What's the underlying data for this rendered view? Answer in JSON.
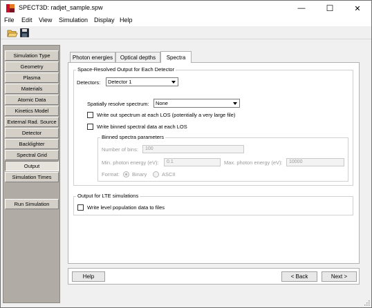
{
  "window": {
    "title": "SPECT3D:  radjet_sample.spw",
    "minimize": "—",
    "maximize": "☐",
    "close": "✕"
  },
  "menu": [
    {
      "label": "File"
    },
    {
      "label": "Edit"
    },
    {
      "label": "View"
    },
    {
      "label": "Simulation"
    },
    {
      "label": "Display"
    },
    {
      "label": "Help"
    }
  ],
  "toolbar": {
    "open_icon": "folder-open-icon",
    "save_icon": "floppy-disk-icon"
  },
  "sidebar": {
    "items": [
      {
        "label": "Simulation Type"
      },
      {
        "label": "Geometry"
      },
      {
        "label": "Plasma"
      },
      {
        "label": "Materials"
      },
      {
        "label": "Atomic Data"
      },
      {
        "label": "Kinetics Model"
      },
      {
        "label": "External Rad. Source"
      },
      {
        "label": "Detector"
      },
      {
        "label": "Backlighter"
      },
      {
        "label": "Spectral Grid"
      },
      {
        "label": "Output",
        "active": true
      },
      {
        "label": "Simulation Times"
      }
    ],
    "run_label": "Run Simulation"
  },
  "tabs": [
    {
      "label": "Photon energies"
    },
    {
      "label": "Optical depths"
    },
    {
      "label": "Spectra",
      "selected": true
    }
  ],
  "space_resolved": {
    "group_title": "Space-Resolved Output for Each Detector",
    "detectors_label": "Detectors:",
    "detectors_value": "Detector 1",
    "spatially_label": "Spatially resolve spectrum:",
    "spatially_value": "None",
    "write_out_label": "Write out spectrum at each LOS (potentially a very large file)",
    "write_out_checked": false,
    "write_binned_label": "Write binned spectral data at each LOS",
    "write_binned_checked": false,
    "binned": {
      "group_title": "Binned spectra parameters",
      "num_bins_label": "Number of bins:",
      "num_bins_value": "100",
      "min_energy_label": "Min. photon energy (eV):",
      "min_energy_value": "0.1",
      "max_energy_label": "Max. photon energy (eV):",
      "max_energy_value": "10000",
      "format_label": "Format:",
      "format_options": [
        "Binary",
        "ASCII"
      ],
      "format_selected": "Binary"
    }
  },
  "lte": {
    "group_title": "Output for LTE simulations",
    "write_level_label": "Write level population data to files",
    "write_level_checked": false
  },
  "buttons": {
    "help": "Help",
    "back": "< Back",
    "next": "Next >"
  },
  "colors": {
    "accent": "#0078d7",
    "sidebar_bg": "#b0aca5",
    "button_face": "#d4d0c8"
  }
}
